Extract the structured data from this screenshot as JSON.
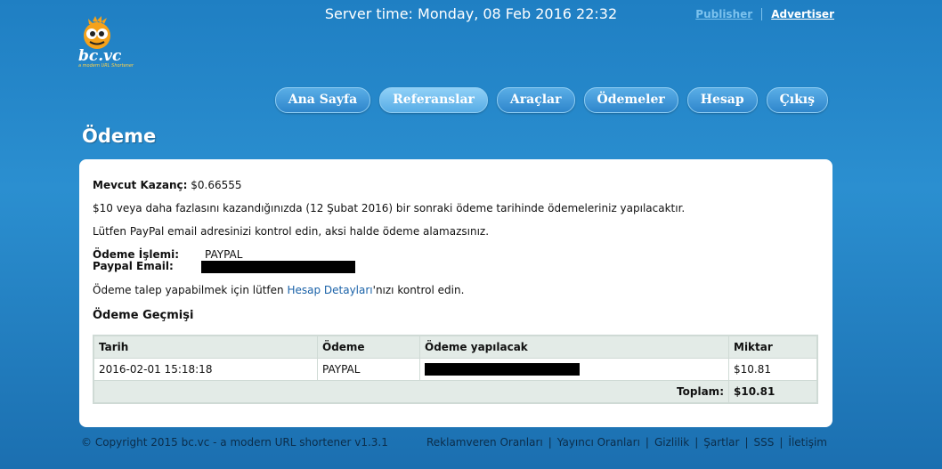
{
  "header": {
    "server_time": "Server time: Monday, 08 Feb 2016 22:32",
    "links": {
      "publisher": "Publisher",
      "advertiser": "Advertiser"
    },
    "logo": {
      "text": "bc.vc",
      "tagline": "a modern URL Shortener"
    }
  },
  "nav": [
    {
      "label": "Ana Sayfa"
    },
    {
      "label": "Referanslar"
    },
    {
      "label": "Araçlar"
    },
    {
      "label": "Ödemeler"
    },
    {
      "label": "Hesap"
    },
    {
      "label": "Çıkış"
    }
  ],
  "page_title": "Ödeme",
  "panel": {
    "earning_label": "Mevcut Kazanç:",
    "earning_value": "$0.66555",
    "info_line_1": "$10 veya daha fazlasını kazandığınızda (12 Şubat 2016) bir sonraki ödeme tarihinde ödemeleriniz yapılacaktır.",
    "info_line_2": "Lütfen PayPal email adresinizi kontrol edin, aksi halde ödeme alamazsınız.",
    "method_label": "Ödeme İşlemi:",
    "method_value": "PAYPAL",
    "email_label": "Paypal Email:",
    "request_prefix": "Ödeme talep yapabilmek için lütfen ",
    "request_link": "Hesap Detayları",
    "request_suffix": "'nızı kontrol edin.",
    "history_title": "Ödeme Geçmişi"
  },
  "history_table": {
    "headers": [
      "Tarih",
      "Ödeme",
      "Ödeme yapılacak",
      "Miktar"
    ],
    "rows": [
      {
        "date": "2016-02-01 15:18:18",
        "method": "PAYPAL",
        "amount": "$10.81"
      }
    ],
    "total_label": "Toplam:",
    "total_value": "$10.81"
  },
  "footer": {
    "copyright": "© Copyright 2015 bc.vc - a modern URL shortener v1.3.1",
    "links": [
      "Reklamveren Oranları",
      "Yayıncı Oranları",
      "Gizlilik",
      "Şartlar",
      "SSS",
      "İletişim"
    ]
  },
  "colors": {
    "background": "#2587c9",
    "nav_button": "#3b92d4",
    "link": "#1a62a8"
  }
}
